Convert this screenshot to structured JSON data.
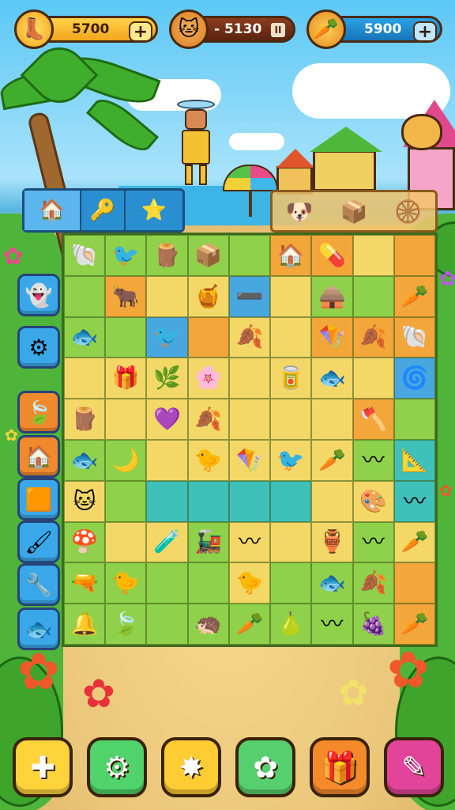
{
  "hud": {
    "currency_1": {
      "icon": "boot-icon",
      "value": "5700"
    },
    "currency_2": {
      "icon": "cat-icon",
      "value": "- 5130"
    },
    "currency_3": {
      "icon": "carrot-icon",
      "value": "5900"
    },
    "plus_label": "+",
    "pause_label": "II"
  },
  "colors": {
    "sky": "#5cc8f5",
    "sand": "#eac679",
    "grass": "#4fb43a",
    "board_green": "#8fd14a",
    "board_yellow": "#f3d868",
    "board_orange": "#f3a63a",
    "board_teal": "#3fc0b8",
    "board_blue": "#49a7e0"
  },
  "info_panel": [
    "house-icon",
    "key-icon",
    "star-icon"
  ],
  "target_panel": [
    "dog-icon",
    "crate-icon",
    "wheel-icon"
  ],
  "side_toolbar": [
    {
      "name": "ghost-icon",
      "glyph": "👻",
      "color": "#3aa8e8"
    },
    {
      "name": "gears-icon",
      "glyph": "⚙",
      "color": "#3aa8e8"
    },
    {
      "name": "leaf-icon",
      "glyph": "🍃",
      "color": "#f08a2c"
    },
    {
      "name": "house-icon",
      "glyph": "🏠",
      "color": "#f08a2c"
    },
    {
      "name": "card-icon",
      "glyph": "🟧",
      "color": "#3aa8e8"
    },
    {
      "name": "paint-icon",
      "glyph": "🖌",
      "color": "#3aa8e8"
    },
    {
      "name": "machine-icon",
      "glyph": "🔧",
      "color": "#3aa8e8"
    },
    {
      "name": "fish-icon",
      "glyph": "🐟",
      "color": "#3aa8e8"
    }
  ],
  "board": {
    "rows": [
      [
        "g:🐚",
        "g:🐦",
        "g:🪵",
        "g:📦",
        "g:",
        "o:🏠",
        "o:💊",
        "y:",
        "o:"
      ],
      [
        "g:",
        "o:🐂",
        "y:",
        "y:🍯",
        "b:➖",
        "y:",
        "g:🛖",
        "g:",
        "o:🥕"
      ],
      [
        "g:🐟",
        "g:",
        "b:🐦",
        "o:",
        "y:🍂",
        "y:",
        "o:🪁",
        "o:🍂",
        "o:🐚"
      ],
      [
        "y:",
        "y:🎁",
        "y:🌿",
        "y:🌸",
        "y:",
        "y:🥫",
        "y:🐟",
        "y:",
        "b:🌀"
      ],
      [
        "y:🪵",
        "y:",
        "y:💜",
        "y:🍂",
        "y:",
        "y:",
        "y:",
        "o:🪓",
        "g:"
      ],
      [
        "g:🐟",
        "g:🌙",
        "y:",
        "y:🐤",
        "y:🪁",
        "y:🐦",
        "y:🥕",
        "g:〰",
        "t:📐"
      ],
      [
        "y:🐱",
        "g:",
        "t:",
        "t:",
        "t:",
        "t:",
        "y:",
        "y:🎨",
        "t:〰"
      ],
      [
        "g:🍄",
        "y:",
        "y:🧪",
        "g:🚂",
        "y:〰",
        "y:",
        "y:🏺",
        "g:〰",
        "y:🥕"
      ],
      [
        "g:🔫",
        "g:🐤",
        "g:",
        "g:",
        "y:🐤",
        "g:",
        "g:🐟",
        "g:🍂",
        "o:"
      ],
      [
        "g:🔔",
        "g:🍃",
        "g:",
        "g:🦔",
        "g:🥕",
        "g:🍐",
        "g:〰",
        "g:🍇",
        "o:🥕"
      ]
    ]
  },
  "bottom_bar": [
    {
      "name": "cross-icon",
      "glyph": "✚",
      "color": "#ffd43a"
    },
    {
      "name": "gear-icon",
      "glyph": "⚙",
      "color": "#4fd36a"
    },
    {
      "name": "star-blast-icon",
      "glyph": "✸",
      "color": "#ffcc33"
    },
    {
      "name": "flower-icon",
      "glyph": "✿",
      "color": "#56d06e"
    },
    {
      "name": "box-icon",
      "glyph": "🎁",
      "color": "#f58a2a"
    },
    {
      "name": "tools-icon",
      "glyph": "✎",
      "color": "#e2449a"
    }
  ]
}
